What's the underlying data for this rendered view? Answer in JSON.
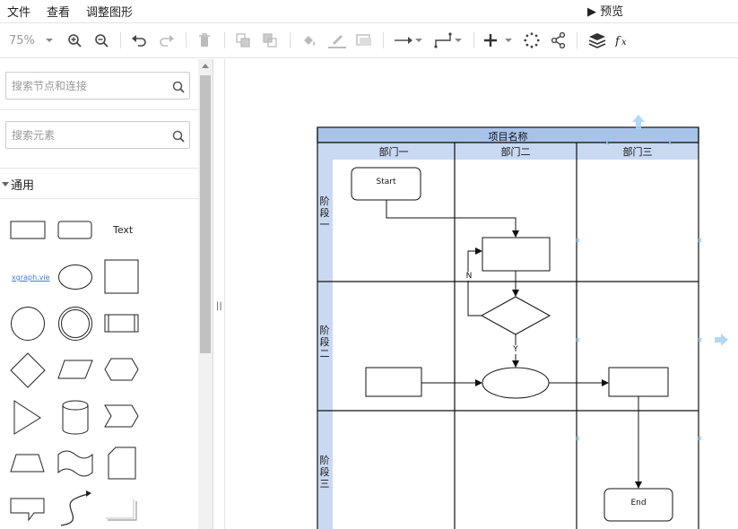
{
  "menu": {
    "items": [
      "文件",
      "查看",
      "调整图形"
    ],
    "preview": "▶ 预览"
  },
  "toolbar": {
    "zoom": "75%"
  },
  "sidebar": {
    "search_nodes_placeholder": "搜索节点和连接",
    "search_elements_placeholder": "搜索元素",
    "section_general": "通用",
    "text_shape_label": "Text",
    "link_shape_label": "xgraph.vie"
  },
  "diagram": {
    "pool_title": "项目名称",
    "lanes": [
      "部门一",
      "部门二",
      "部门三"
    ],
    "phases": [
      "阶段一",
      "阶段二",
      "阶段三"
    ],
    "start_label": "Start",
    "end_label": "End",
    "no_label": "N",
    "yes_label": "Y"
  },
  "colors": {
    "lane_header": "#c9d9f2",
    "pool_header": "#a8c3ea",
    "handle": "#a8d4f4"
  }
}
